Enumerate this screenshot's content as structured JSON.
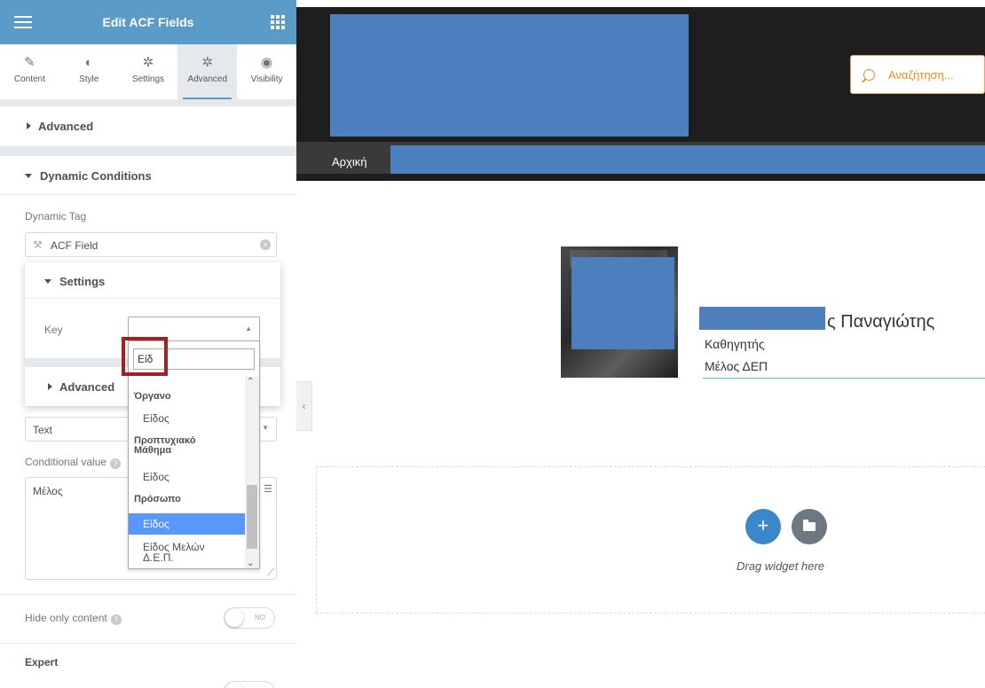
{
  "panel": {
    "title": "Edit ACF Fields",
    "tabs": [
      {
        "label": "Content",
        "icon": "pencil-icon"
      },
      {
        "label": "Style",
        "icon": "half-circle-icon"
      },
      {
        "label": "Settings",
        "icon": "gear-icon"
      },
      {
        "label": "Advanced",
        "icon": "gear-icon"
      },
      {
        "label": "Visibility",
        "icon": "eye-icon"
      }
    ],
    "active_tab": "Advanced",
    "sections": {
      "advanced": "Advanced",
      "dynamic_conditions": "Dynamic Conditions",
      "expert": "Expert"
    },
    "dynamic_tag_label": "Dynamic Tag",
    "dynamic_tag_value": "ACF Field",
    "popover": {
      "settings_title": "Settings",
      "key_label": "Key",
      "advanced_title": "Advanced"
    },
    "condition_select_value": "Text",
    "conditional_value_label": "Conditional value",
    "conditional_value_text": "Μέλος",
    "hide_only_content_label": "Hide only content",
    "hide_toggle_text": "NO"
  },
  "dropdown": {
    "search_value": "Είδ",
    "groups": [
      {
        "name": "Όργανο",
        "options": [
          "Είδος"
        ]
      },
      {
        "name": "Προπτυχιακό Μάθημα",
        "options": [
          "Είδος"
        ]
      },
      {
        "name": "Πρόσωπο",
        "options": [
          "Είδος",
          "Είδος Μελών Δ.Ε.Π."
        ]
      }
    ],
    "selected": "Είδος",
    "accent": "#5897fb"
  },
  "preview": {
    "search_placeholder": "Αναζήτηση...",
    "nav_home": "Αρχική",
    "person": {
      "name_visible": "ς Παναγιώτης",
      "title": "Καθηγητής",
      "role": "Μέλος ΔΕΠ"
    },
    "drop_hint": "Drag widget here",
    "add_symbol": "+"
  },
  "colors": {
    "header": "#5b9bc7",
    "redaction": "#4e7fbd",
    "highlight": "#a31f24",
    "search_accent": "#f08a24"
  }
}
